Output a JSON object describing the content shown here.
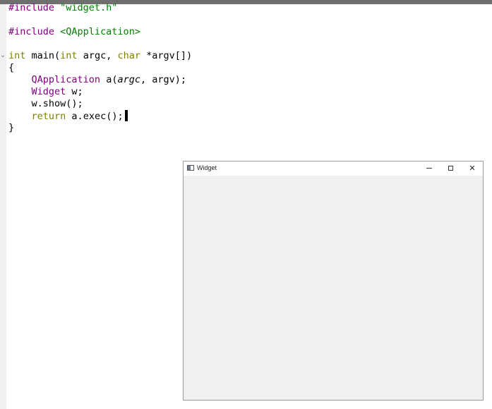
{
  "editor": {
    "lines": [
      {
        "segments": [
          {
            "text": "#include ",
            "cls": "kw"
          },
          {
            "text": "\"widget.h\"",
            "cls": "str"
          }
        ]
      },
      {
        "segments": []
      },
      {
        "segments": [
          {
            "text": "#include ",
            "cls": "kw"
          },
          {
            "text": "<QApplication>",
            "cls": "str"
          }
        ]
      },
      {
        "segments": []
      },
      {
        "segments": [
          {
            "text": "int",
            "cls": "type"
          },
          {
            "text": " main(",
            "cls": "plain"
          },
          {
            "text": "int",
            "cls": "type"
          },
          {
            "text": " argc, ",
            "cls": "plain"
          },
          {
            "text": "char",
            "cls": "type"
          },
          {
            "text": " *argv[])",
            "cls": "plain"
          }
        ]
      },
      {
        "segments": [
          {
            "text": "{",
            "cls": "plain"
          }
        ]
      },
      {
        "segments": [
          {
            "text": "    ",
            "cls": "plain"
          },
          {
            "text": "QApplication",
            "cls": "cls"
          },
          {
            "text": " a(",
            "cls": "plain"
          },
          {
            "text": "argc",
            "cls": "plain ital"
          },
          {
            "text": ", argv);",
            "cls": "plain"
          }
        ]
      },
      {
        "segments": [
          {
            "text": "    ",
            "cls": "plain"
          },
          {
            "text": "Widget",
            "cls": "cls"
          },
          {
            "text": " w;",
            "cls": "plain"
          }
        ]
      },
      {
        "segments": [
          {
            "text": "    w.",
            "cls": "plain"
          },
          {
            "text": "show",
            "cls": "plain"
          },
          {
            "text": "();",
            "cls": "plain"
          }
        ]
      },
      {
        "segments": [
          {
            "text": "    ",
            "cls": "plain"
          },
          {
            "text": "return",
            "cls": "type"
          },
          {
            "text": " a.",
            "cls": "plain"
          },
          {
            "text": "exec",
            "cls": "plain"
          },
          {
            "text": "();",
            "cls": "plain"
          }
        ],
        "cursor": true
      },
      {
        "segments": [
          {
            "text": "}",
            "cls": "plain"
          }
        ]
      }
    ]
  },
  "widget_window": {
    "title": "Widget",
    "icon": "window-icon",
    "controls": {
      "minimize": "minimize-icon",
      "maximize": "maximize-icon",
      "close": "✕"
    }
  },
  "colors": {
    "keyword": "#800080",
    "string": "#008000",
    "type": "#808000",
    "window_bg": "#f0f0f0"
  }
}
